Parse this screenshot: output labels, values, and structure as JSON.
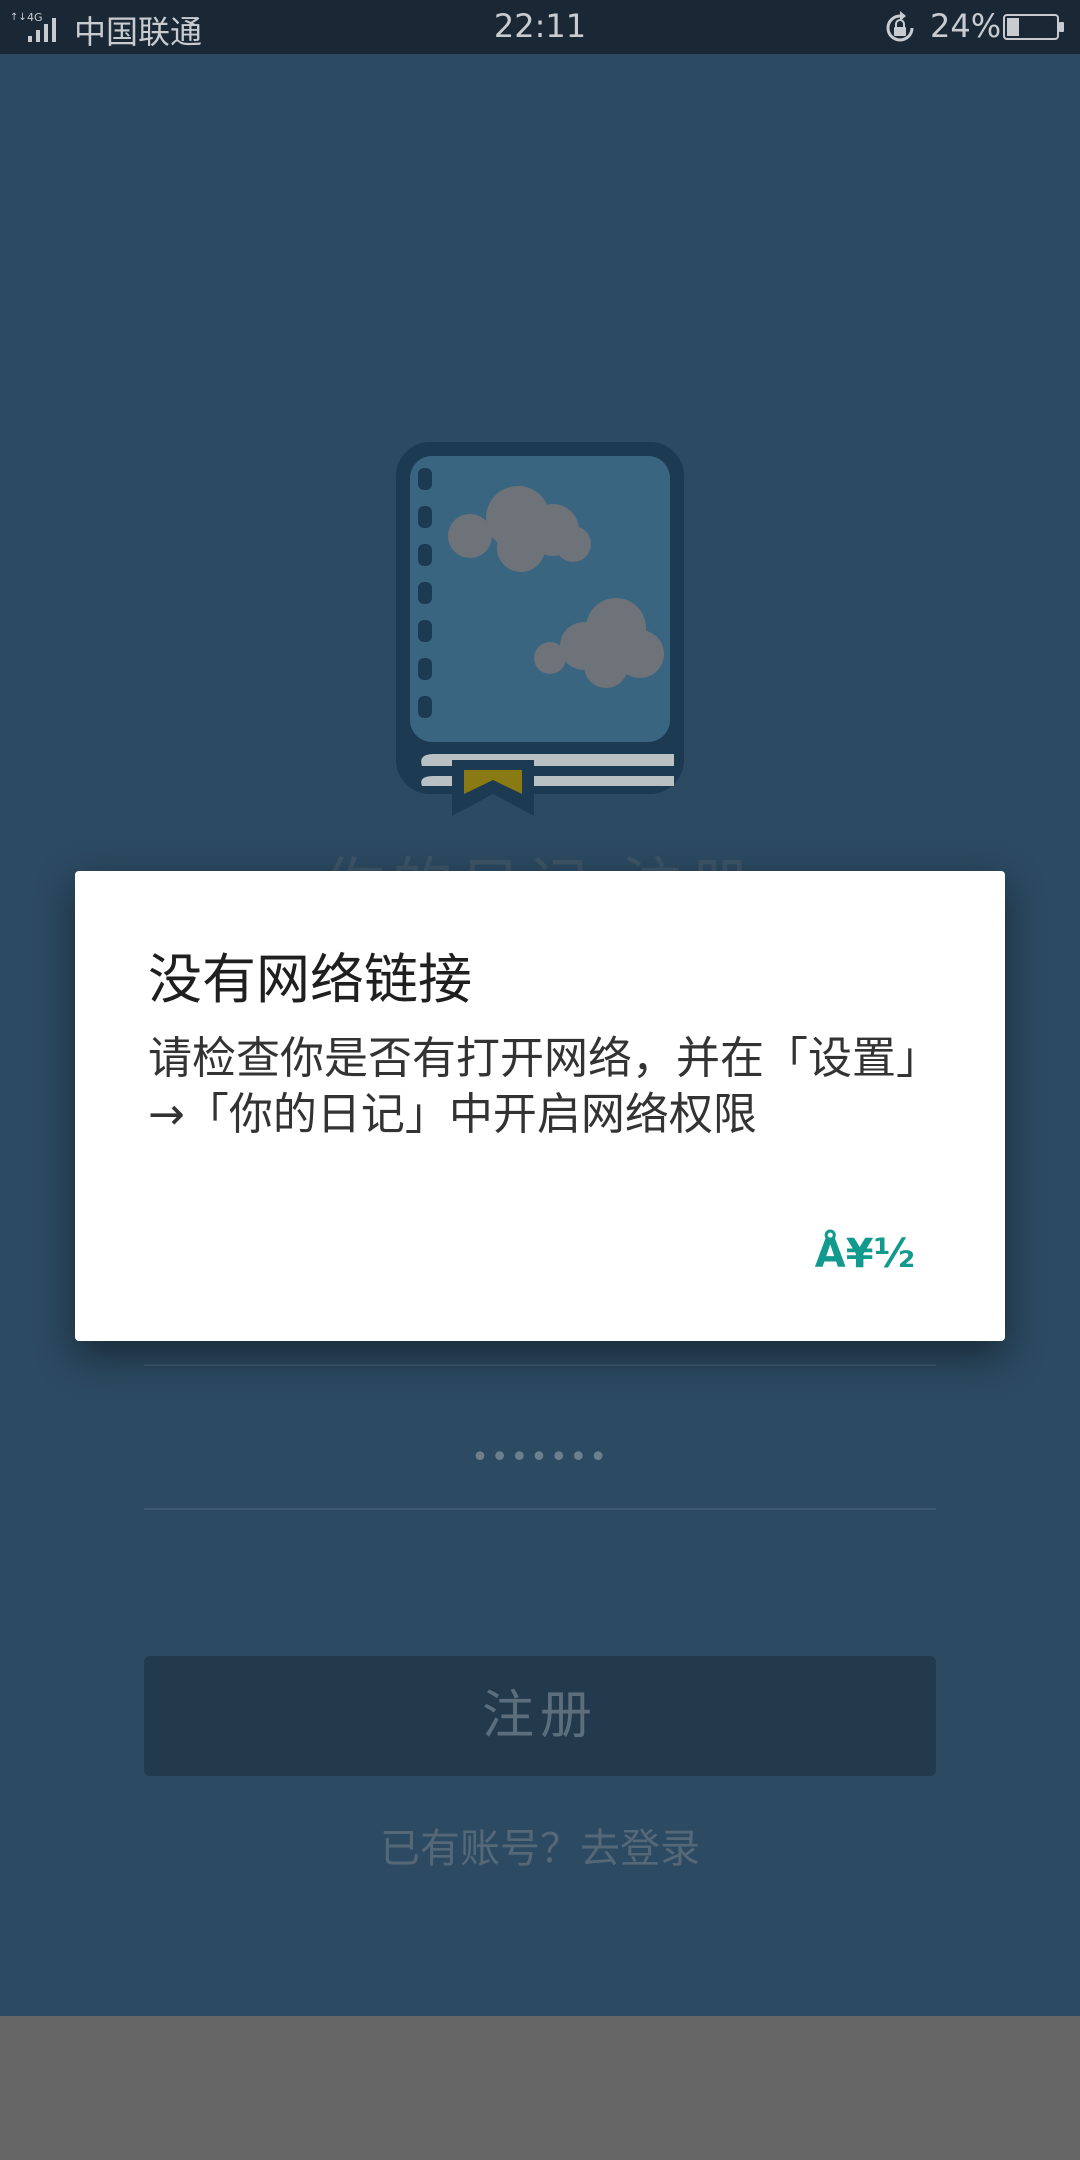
{
  "status_bar": {
    "network_type": "4G",
    "carrier": "中国联通",
    "time": "22:11",
    "battery_percent": "24%",
    "battery_level": 0.24,
    "icons": [
      "signal-icon",
      "rotate-lock-icon",
      "battery-icon"
    ]
  },
  "background_screen": {
    "app_title": "你的日记 注册",
    "password_mask": "•••••••",
    "register_label": "注册",
    "login_link": "已有账号？去登录"
  },
  "dialog": {
    "title": "没有网络链接",
    "message": "请检查你是否有打开网络，并在「设置」→「你的日记」中开启网络权限",
    "ok_label": "Å¥½"
  },
  "colors": {
    "app_background": "#2c4a62",
    "status_bar": "#1a2734",
    "dialog_accent": "#129a8e",
    "bookmark": "#8a7a14"
  }
}
